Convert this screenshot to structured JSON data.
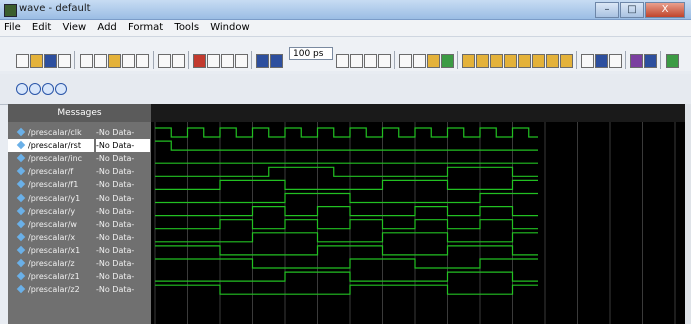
{
  "window": {
    "title": "wave - default",
    "min": "–",
    "max": "□",
    "close": "X"
  },
  "menu": [
    "File",
    "Edit",
    "View",
    "Add",
    "Format",
    "Tools",
    "Window"
  ],
  "toolbar": {
    "time_value": "100 ps"
  },
  "panel": {
    "header": "Messages"
  },
  "signals": [
    {
      "name": "/prescalar/clk",
      "value": "-No Data-"
    },
    {
      "name": "/prescalar/rst",
      "value": "-No Data-"
    },
    {
      "name": "/prescalar/inc",
      "value": "-No Data-"
    },
    {
      "name": "/prescalar/f",
      "value": "-No Data-"
    },
    {
      "name": "/prescalar/f1",
      "value": "-No Data-"
    },
    {
      "name": "/prescalar/y1",
      "value": "-No Data-"
    },
    {
      "name": "/prescalar/y",
      "value": "-No Data-"
    },
    {
      "name": "/prescalar/w",
      "value": "-No Data-"
    },
    {
      "name": "/prescalar/x",
      "value": "-No Data-"
    },
    {
      "name": "/prescalar/x1",
      "value": "-No Data-"
    },
    {
      "name": "/prescalar/z",
      "value": "-No Data-"
    },
    {
      "name": "/prescalar/z1",
      "value": "-No Data-"
    },
    {
      "name": "/prescalar/z2",
      "value": "-No Data-"
    }
  ],
  "colors": {
    "wave": "#22c022",
    "wave_bg": "#000000"
  }
}
